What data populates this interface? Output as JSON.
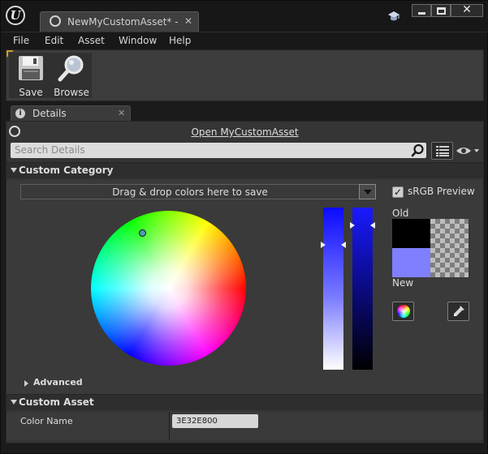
{
  "titlebar": {
    "logo": "U",
    "tab_label": "NewMyCustomAsset* - Ge",
    "tab_close": "✕",
    "close_glyph": "✕"
  },
  "menubar": {
    "items": [
      "File",
      "Edit",
      "Asset",
      "Window",
      "Help"
    ]
  },
  "toolbar": {
    "save_label": "Save",
    "browse_label": "Browse"
  },
  "details_tab": {
    "icon_glyph": "i",
    "label": "Details",
    "close": "✕"
  },
  "details": {
    "open_asset_link": "Open MyCustomAsset",
    "search_placeholder": "Search Details",
    "category_custom": "Custom Category",
    "category_asset": "Custom Asset"
  },
  "color_picker": {
    "themes_text": "Drag & drop colors here to save",
    "srgb_checked": "✓",
    "srgb_label": "sRGB Preview",
    "old_label": "Old",
    "new_label": "New",
    "old_color": "#000000",
    "new_color": "#7f7fff",
    "advanced_label": "Advanced"
  },
  "property": {
    "name": "Color Name",
    "value": "3E32E800"
  },
  "icons": {
    "logo": "unreal-logo-icon",
    "save": "floppy-disk-icon",
    "browse": "magnifier-icon",
    "search": "search-icon",
    "view": "list-view-icon",
    "eye": "eye-icon",
    "wheel": "color-wheel-icon",
    "dropper": "eyedropper-icon"
  }
}
